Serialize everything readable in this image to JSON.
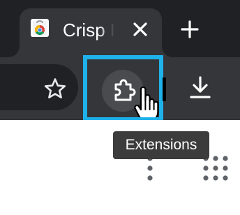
{
  "tab": {
    "title": "Crisp F",
    "favicon": "chrome-web-store-icon",
    "close_icon": "close-icon"
  },
  "toolbar": {
    "new_tab_icon": "plus-icon",
    "bookmark_icon": "star-icon",
    "extensions_icon": "puzzle-icon",
    "download_icon": "download-icon"
  },
  "tooltip": {
    "text": "Extensions"
  },
  "page": {
    "menu_icon": "vertical-dots-icon",
    "apps_icon": "grid-dots-icon"
  },
  "colors": {
    "tab_strip": "#202124",
    "toolbar": "#35363a",
    "highlight": "#1fb2ea",
    "tooltip_bg": "#3c3c3c",
    "page_icons": "#5f6368"
  }
}
